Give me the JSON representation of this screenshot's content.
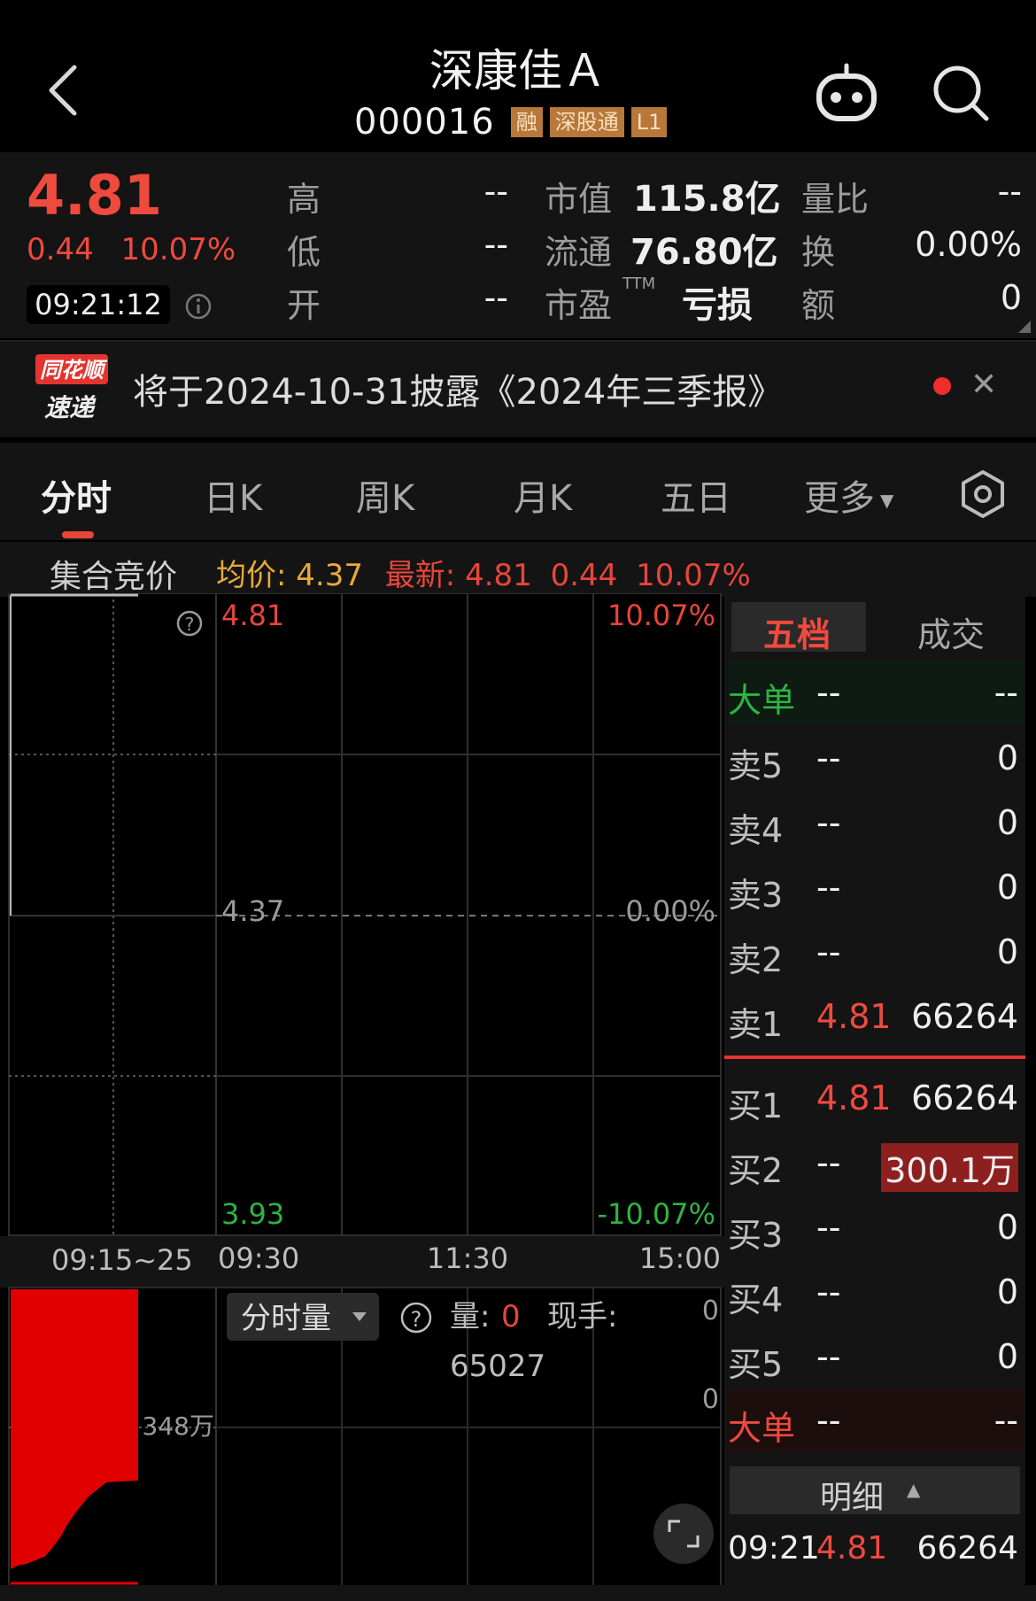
{
  "header": {
    "title": "深康佳Ａ",
    "code": "000016",
    "tags": [
      "融",
      "深股通",
      "L1"
    ]
  },
  "quote": {
    "price": "4.81",
    "change": "0.44",
    "change_pct": "10.07%",
    "time": "09:21:12",
    "high_label": "高",
    "high_value": "--",
    "low_label": "低",
    "low_value": "--",
    "open_label": "开",
    "open_value": "--",
    "mktcap_label": "市值",
    "mktcap_value": "115.8亿",
    "float_label": "流通",
    "float_value": "76.80亿",
    "pe_label": "市盈",
    "pe_ttm": "TTM",
    "pe_value": "亏损",
    "volratio_label": "量比",
    "volratio_value": "--",
    "turnover_label": "换",
    "turnover_value": "0.00%",
    "amount_label": "额",
    "amount_value": "0"
  },
  "news": {
    "logo_line1": "同花顺",
    "logo_line2": "速递",
    "text": "将于2024-10-31披露《2024年三季报》"
  },
  "tabs": [
    "分时",
    "日K",
    "周K",
    "月K",
    "五日",
    "更多"
  ],
  "subheader": {
    "auction": "集合竞价",
    "avg_label": "均价:",
    "avg_value": "4.37",
    "latest_label": "最新:",
    "latest_value": "4.81",
    "latest_change": "0.44",
    "latest_pct": "10.07%"
  },
  "chart": {
    "price_top": "4.81",
    "pct_top": "10.07%",
    "price_mid": "4.37",
    "pct_mid": "0.00%",
    "price_bottom": "3.93",
    "pct_bottom": "-10.07%",
    "time_auction": "09:15~25",
    "time_open": "09:30",
    "time_mid": "11:30",
    "time_close": "15:00",
    "vol_mark": "348万",
    "vol_selector": "分时量",
    "vol_label": "量:",
    "vol_value": "0",
    "hand_label": "现手:",
    "hand_value": "65027",
    "vol_axis_top": "0",
    "vol_axis_mid": "0",
    "colors": {
      "up": "#e8453c",
      "down": "#2fb344",
      "grid": "#333333"
    }
  },
  "orderbook": {
    "tab_active": "五档",
    "tab_other": "成交",
    "big_sell_label": "大单",
    "big_sell_price": "--",
    "big_sell_vol": "--",
    "sell": [
      {
        "label": "卖5",
        "price": "--",
        "vol": "0"
      },
      {
        "label": "卖4",
        "price": "--",
        "vol": "0"
      },
      {
        "label": "卖3",
        "price": "--",
        "vol": "0"
      },
      {
        "label": "卖2",
        "price": "--",
        "vol": "0"
      },
      {
        "label": "卖1",
        "price": "4.81",
        "vol": "66264"
      }
    ],
    "buy": [
      {
        "label": "买1",
        "price": "4.81",
        "vol": "66264"
      },
      {
        "label": "买2",
        "price": "--",
        "vol": "300.1万"
      },
      {
        "label": "买3",
        "price": "--",
        "vol": "0"
      },
      {
        "label": "买4",
        "price": "--",
        "vol": "0"
      },
      {
        "label": "买5",
        "price": "--",
        "vol": "0"
      }
    ],
    "big_buy_label": "大单",
    "big_buy_price": "--",
    "big_buy_vol": "--",
    "detail_label": "明细",
    "detail_time": "09:21",
    "detail_price": "4.81",
    "detail_vol": "66264"
  }
}
